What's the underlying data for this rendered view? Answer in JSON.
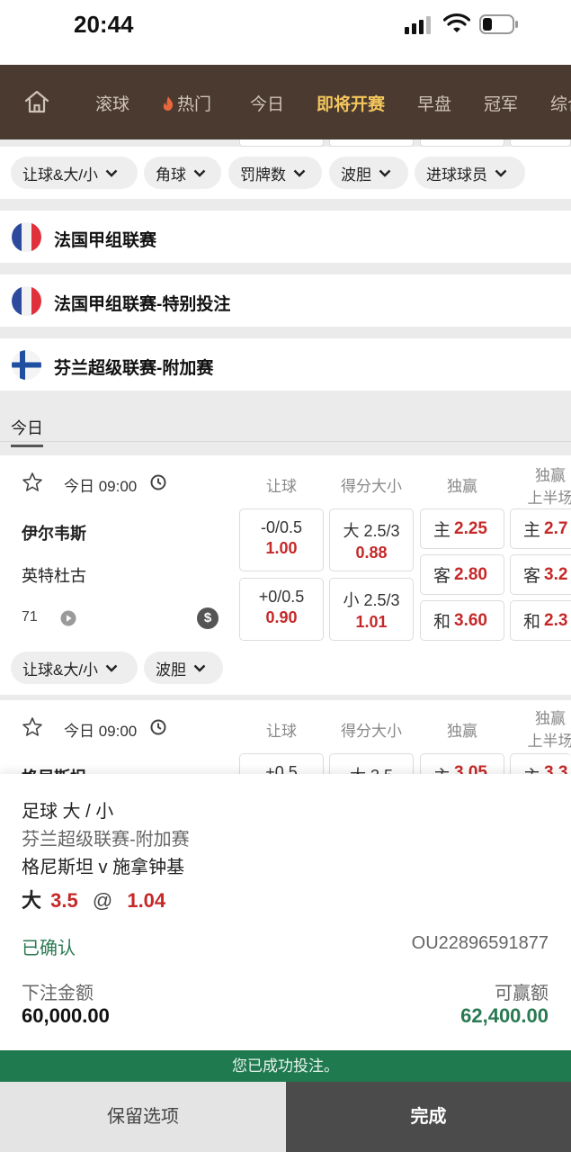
{
  "status_bar": {
    "time": "20:44"
  },
  "nav": {
    "items": [
      "滚球",
      "热门",
      "今日",
      "即将开赛",
      "早盘",
      "冠军",
      "综合"
    ],
    "active": "即将开赛"
  },
  "filters_top": [
    "让球&大/小",
    "角球",
    "罚牌数",
    "波胆",
    "进球球员"
  ],
  "leagues": [
    {
      "name": "法国甲组联赛",
      "flag": "france-flag-icon"
    },
    {
      "name": "法国甲组联赛-特别投注",
      "flag": "france-flag-icon"
    },
    {
      "name": "芬兰超级联赛-附加赛",
      "flag": "finland-flag-icon"
    }
  ],
  "date_tab": "今日",
  "columns": {
    "handicap": "让球",
    "total": "得分大小",
    "win": "独赢",
    "win_half_1": "独赢",
    "win_half_2": "上半场"
  },
  "match1": {
    "kickoff": "今日 09:00",
    "home": "伊尔韦斯",
    "away": "英特杜古",
    "minute": "71",
    "hdp_home_line": "-0/0.5",
    "hdp_home_odd": "1.00",
    "hdp_away_line": "+0/0.5",
    "hdp_away_odd": "0.90",
    "ou_over_line": "大 2.5/3",
    "ou_over_odd": "0.88",
    "ou_under_line": "小 2.5/3",
    "ou_under_odd": "1.01",
    "win_home_label": "主",
    "win_home_odd": "2.25",
    "win_away_label": "客",
    "win_away_odd": "2.80",
    "win_draw_label": "和",
    "win_draw_odd": "3.60",
    "half_home_label": "主",
    "half_home_odd": "2.7",
    "half_away_label": "客",
    "half_away_odd": "3.2",
    "half_draw_label": "和",
    "half_draw_odd": "2.3",
    "filters": [
      "让球&大/小",
      "波胆"
    ]
  },
  "match2": {
    "kickoff": "今日 09:00",
    "home_partial": "格尼斯坦",
    "hdp_partial": "+0.5",
    "ou_partial": "大 3.5",
    "win_partial_label": "主",
    "win_partial_odd": "3.05",
    "half_partial_label": "主",
    "half_partial_odd": "3.3"
  },
  "bet_slip": {
    "sport_market": "足球 大 / 小",
    "league": "芬兰超级联赛-附加赛",
    "fixture": "格尼斯坦 v 施拿钟基",
    "selection": "大",
    "line": "3.5",
    "at": "@",
    "odds": "1.04",
    "status": "已确认",
    "ticket_id": "OU22896591877",
    "stake_label": "下注金额",
    "stake": "60,000.00",
    "payout_label": "可赢额",
    "payout": "62,400.00"
  },
  "success_message": "您已成功投注。",
  "buttons": {
    "keep": "保留选项",
    "done": "完成"
  },
  "colors": {
    "nav_bg": "#4a3a30",
    "active": "#f3c55c",
    "odd_red": "#c62828",
    "success_green": "#1f7a4f"
  }
}
